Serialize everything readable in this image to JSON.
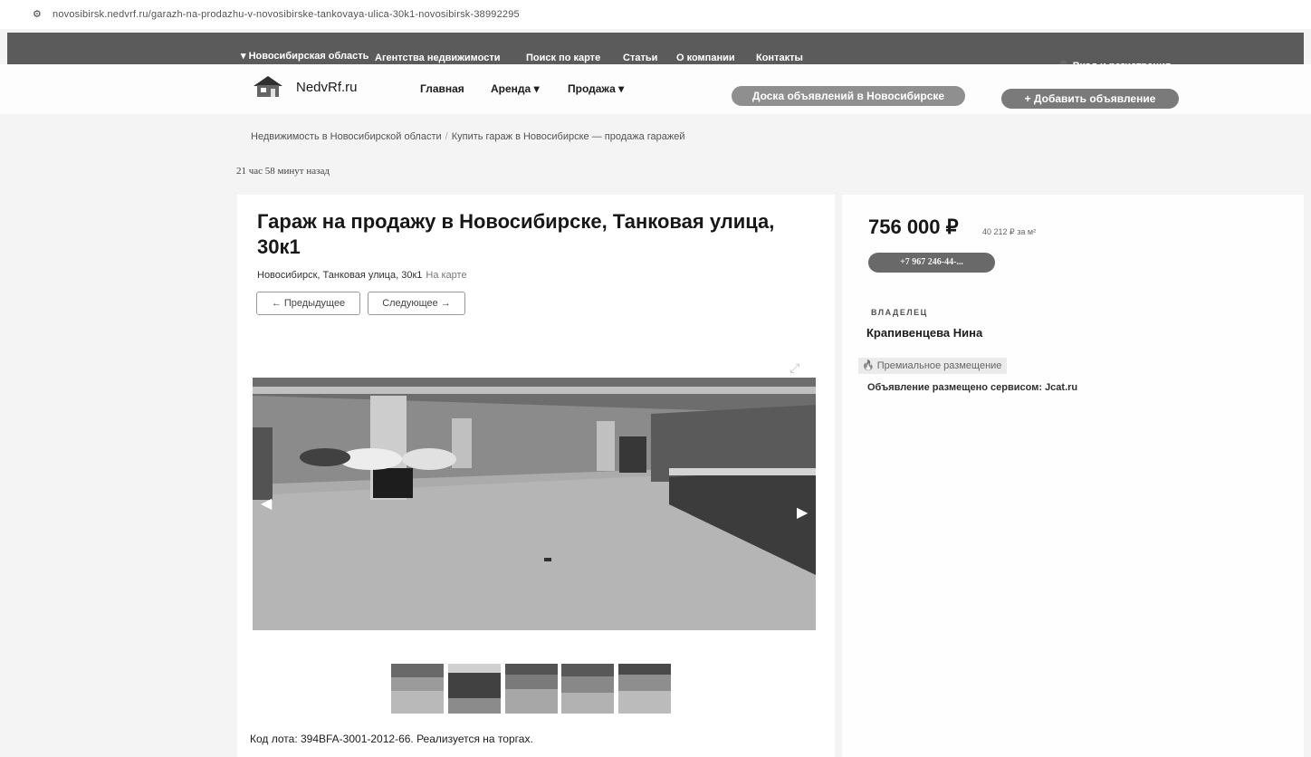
{
  "browser": {
    "site_icon": "site-settings-icon",
    "url": "novosibirsk.nedvrf.ru/garazh-na-prodazhu-v-novosibirske-tankovaya-ulica-30k1-novosibirsk-38992295"
  },
  "topbar": {
    "region": "Новосибирская область",
    "nav": [
      "Агентства недвижимости",
      "Поиск по карте",
      "Статьи",
      "О компании",
      "Контакты"
    ],
    "login": "Вход и регистрация"
  },
  "header": {
    "brand": "NedvRf.ru",
    "nav": [
      "Главная",
      "Аренда",
      "Продажа"
    ],
    "board_button": "Доска объявлений в Новосибирске",
    "add_button": "+ Добавить объявление"
  },
  "breadcrumbs": [
    "Недвижимость в Новосибирской области",
    "Купить гараж в Новосибирске — продажа гаражей"
  ],
  "posted": "21 час 58 минут назад",
  "listing": {
    "title": "Гараж на продажу в Новосибирске, Танковая улица, 30к1",
    "address": "Новосибирск, Танковая улица, 30к1",
    "map_link": "На карте",
    "prev": "← Предыдущее",
    "next": "Следующее →",
    "lot": "Код лота: 394BFA-3001-2012-66. Реализуется на торгах."
  },
  "sidebar": {
    "price": "756 000 ₽",
    "price_per_m2": "40 212 ₽ за м²",
    "phone": "+7 967 246-44-...",
    "owner_label": "ВЛАДЕЛЕЦ",
    "owner_name": "Крапивенцева Нина",
    "premium": "Премиальное размещение",
    "service": "Объявление размещено сервисом: Jcat.ru"
  },
  "colors": {
    "topbar": "#5d5d5d",
    "pill": "#8e8e8e",
    "phone_button": "#6a6a6a"
  }
}
